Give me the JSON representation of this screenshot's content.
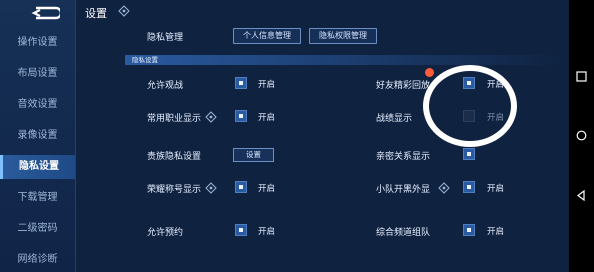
{
  "header": {
    "title": "设置"
  },
  "sidebar": {
    "items": [
      {
        "label": "操作设置"
      },
      {
        "label": "布局设置"
      },
      {
        "label": "音效设置"
      },
      {
        "label": "录像设置"
      },
      {
        "label": "隐私设置"
      },
      {
        "label": "下载管理"
      },
      {
        "label": "二级密码"
      },
      {
        "label": "网络诊断"
      }
    ],
    "active_index": 4
  },
  "privacy": {
    "label": "隐私管理",
    "buttons": [
      "个人信息管理",
      "隐私权限管理"
    ],
    "section": "隐私设置"
  },
  "settings": {
    "allow_watch": {
      "label": "允许观战",
      "state": "开启"
    },
    "friend_highlight": {
      "label": "好友精彩回放",
      "state": "开启"
    },
    "common_job": {
      "label": "常用职业显示",
      "state": "开启"
    },
    "battle_record": {
      "label": "战绩显示",
      "state": "开启"
    },
    "noble_privacy": {
      "label": "贵族隐私设置",
      "button": "设置"
    },
    "intimate_display": {
      "label": "亲密关系显示"
    },
    "honor_title": {
      "label": "荣耀称号显示",
      "state": "开启"
    },
    "team_appearance": {
      "label": "小队开黑外显",
      "state": "开启"
    },
    "allow_reserve": {
      "label": "允许预约",
      "state": "开启"
    },
    "channel_team": {
      "label": "综合频道组队",
      "state": "开启"
    }
  },
  "colors": {
    "background": "#0f2240",
    "accent": "#2a5aa0",
    "annotation": "#ffffff"
  }
}
